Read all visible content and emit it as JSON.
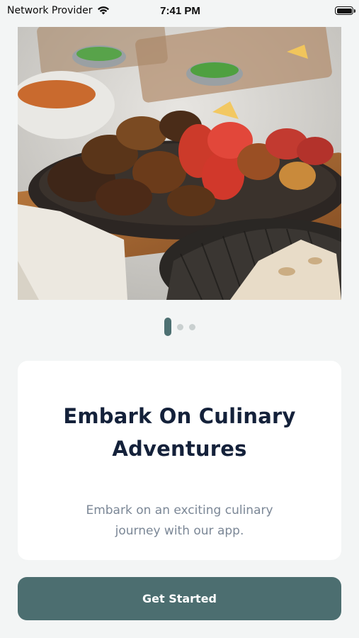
{
  "status_bar": {
    "carrier": "Network Provider",
    "time": "7:41 PM"
  },
  "hero": {
    "image_alt": "grilled-kebab-platter-photo"
  },
  "pagination": {
    "count": 3,
    "active_index": 0
  },
  "card": {
    "title": "Embark On Culinary Adventures",
    "subtitle": "Embark on an exciting culinary journey with our app."
  },
  "cta": {
    "label": "Get Started"
  },
  "colors": {
    "primary": "#4c6e70",
    "title": "#14213a",
    "subtitle": "#7b8796",
    "background": "#f3f5f5"
  }
}
